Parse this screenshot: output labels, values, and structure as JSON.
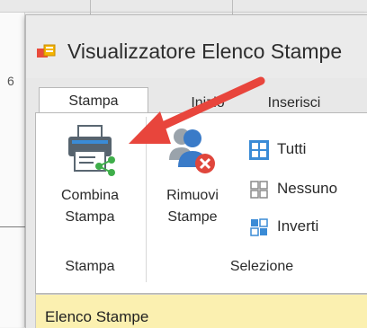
{
  "background": {
    "side_text": "6"
  },
  "window": {
    "title": "Visualizzatore Elenco Stampe"
  },
  "ribbon": {
    "tabs": [
      {
        "label": "Stampa",
        "active": true
      },
      {
        "label": "Inizio",
        "active": false
      },
      {
        "label": "Inserisci",
        "active": false
      }
    ],
    "groups": {
      "stampa": {
        "label": "Stampa",
        "combina_line1": "Combina",
        "combina_line2": "Stampa"
      },
      "selezione": {
        "label": "Selezione",
        "rimuovi_line1": "Rimuovi",
        "rimuovi_line2": "Stampe",
        "tutti": "Tutti",
        "nessuno": "Nessuno",
        "inverti": "Inverti"
      }
    }
  },
  "list": {
    "header": "Elenco Stampe"
  },
  "colors": {
    "arrow": "#e8453c",
    "accent_blue": "#3a8bd6",
    "list_bg": "#fbf0b0",
    "share_green": "#3fae4a",
    "remove_red": "#e0463c"
  },
  "icons": {
    "app": "app-icon",
    "combina": "printer-share-icon",
    "rimuovi": "users-remove-icon",
    "tutti": "grid-all-selected-icon",
    "nessuno": "grid-none-selected-icon",
    "inverti": "grid-invert-icon"
  }
}
